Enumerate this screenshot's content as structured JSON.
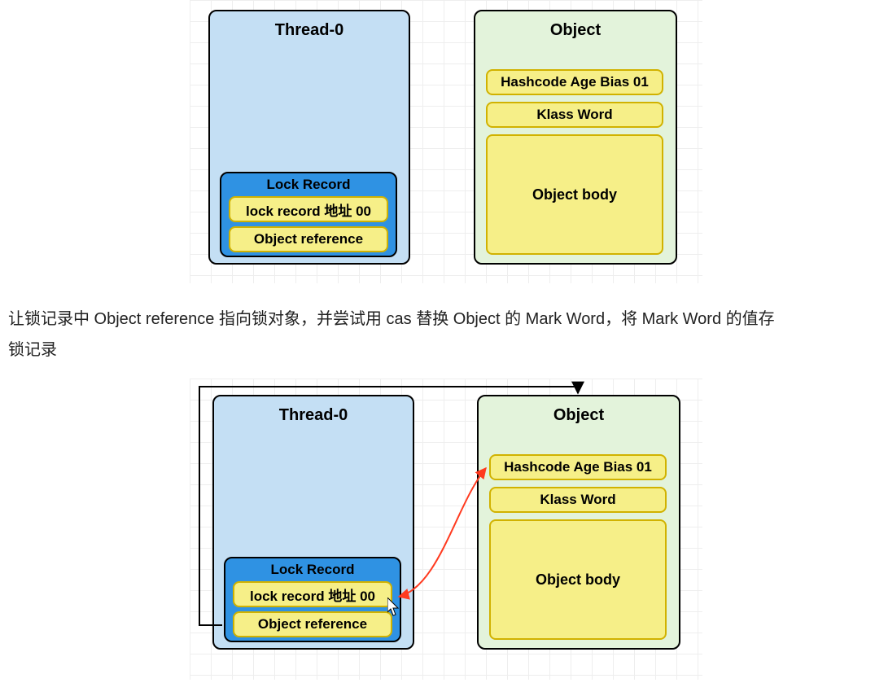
{
  "diagram1": {
    "thread_title": "Thread-0",
    "lock_record_title": "Lock Record",
    "lock_record_addr": "lock record 地址 00",
    "object_ref": "Object reference",
    "object_title": "Object",
    "hashcode": "Hashcode Age Bias 01",
    "klass": "Klass Word",
    "body": "Object body"
  },
  "paragraph": {
    "line1": "让锁记录中 Object reference 指向锁对象，并尝试用 cas 替换 Object 的 Mark Word，将 Mark Word 的值存",
    "line2": "锁记录"
  },
  "diagram2": {
    "thread_title": "Thread-0",
    "lock_record_title": "Lock Record",
    "lock_record_addr": "lock record 地址 00",
    "object_ref": "Object reference",
    "object_title": "Object",
    "hashcode": "Hashcode Age Bias 01",
    "klass": "Klass Word",
    "body": "Object body"
  }
}
